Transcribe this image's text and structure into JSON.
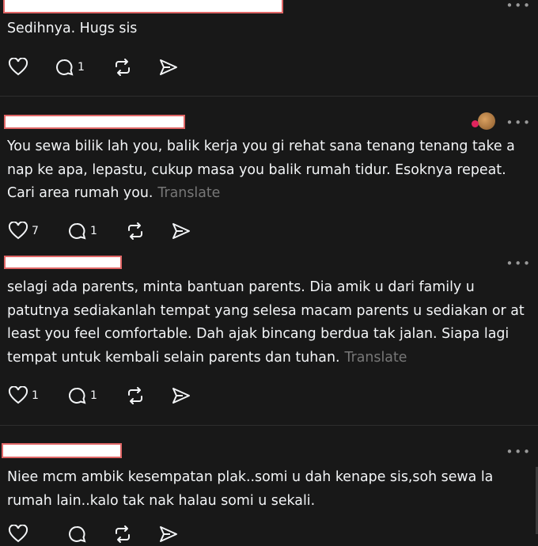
{
  "posts": [
    {
      "text": "Sedihnya. Hugs sis",
      "translate": "",
      "likes": "",
      "replies": "1"
    },
    {
      "text": "You sewa bilik lah you, balik kerja you gi rehat sana tenang tenang take a nap ke apa, lepastu, cukup masa you balik rumah tidur. Esoknya repeat. Cari area rumah you.",
      "translate": "Translate",
      "likes": "7",
      "replies": "1"
    },
    {
      "text": "selagi ada parents, minta bantuan parents. Dia amik u dari family u patutnya sediakanlah tempat yang selesa macam parents u sediakan or at least you feel comfortable. Dah ajak bincang berdua tak jalan. Siapa lagi tempat untuk kembali selain parents dan tuhan.",
      "translate": "Translate",
      "likes": "1",
      "replies": "1"
    },
    {
      "text": "Niee mcm ambik kesempatan plak..somi u dah kenape sis,soh sewa la rumah lain..kalo tak nak halau somi u sekali.",
      "translate": "",
      "likes": "",
      "replies": ""
    }
  ],
  "more_glyph": "•••",
  "icons": {
    "like": "heart-icon",
    "reply": "comment-icon",
    "repost": "repost-icon",
    "share": "send-icon",
    "more": "more-icon"
  },
  "colors": {
    "background": "#181818",
    "text": "#f3f5f7",
    "muted": "#777777",
    "redaction_fill": "#ffffff",
    "redaction_border": "#e06666"
  }
}
